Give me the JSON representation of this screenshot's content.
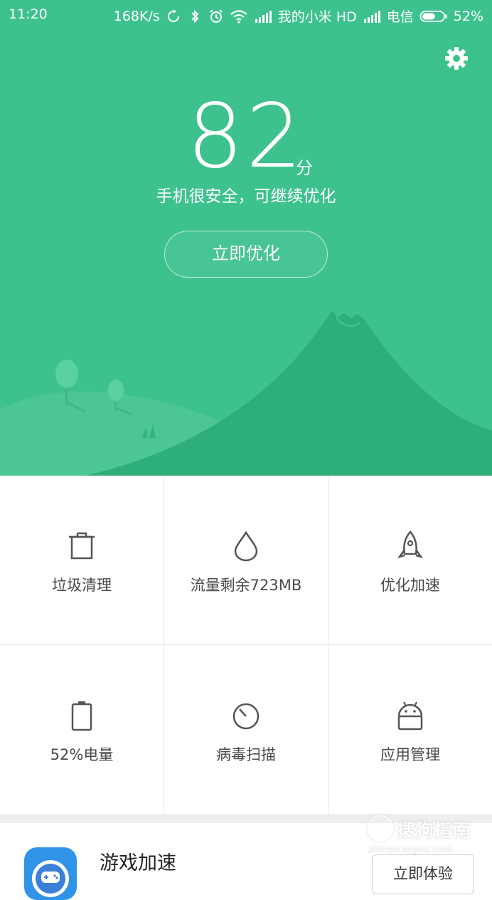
{
  "status_bar": {
    "time": "11:20",
    "speed": "168K/s",
    "carrier1": "我的小米 HD",
    "carrier2": "电信",
    "battery": "52%"
  },
  "hero": {
    "score": "82",
    "score_unit": "分",
    "description": "手机很安全，可继续优化",
    "optimize_button": "立即优化"
  },
  "tools": [
    {
      "label": "垃圾清理",
      "icon": "trash-icon"
    },
    {
      "label": "流量剩余723MB",
      "icon": "droplet-icon"
    },
    {
      "label": "优化加速",
      "icon": "rocket-icon"
    },
    {
      "label": "52%电量",
      "icon": "battery-icon"
    },
    {
      "label": "病毒扫描",
      "icon": "scan-icon"
    },
    {
      "label": "应用管理",
      "icon": "android-icon"
    }
  ],
  "game": {
    "title": "游戏加速",
    "button": "立即体验",
    "icon": "gamepad-icon"
  },
  "watermark": {
    "main": "搜狗指南",
    "sub": "zhinan.sogou.com"
  },
  "colors": {
    "hero_bg": "#3dc28e",
    "mountain": "#2eae78"
  }
}
